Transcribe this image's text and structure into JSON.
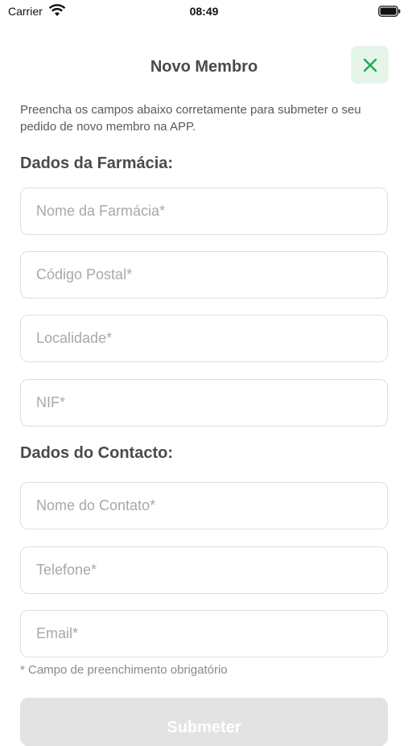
{
  "status_bar": {
    "carrier": "Carrier",
    "time": "08:49"
  },
  "header": {
    "title": "Novo Membro",
    "close_icon": "close-icon"
  },
  "intro_text": "Preencha os campos abaixo corretamente para submeter o seu pedido de novo membro na APP.",
  "sections": {
    "pharmacy": {
      "title": "Dados da Farmácia:",
      "fields": [
        {
          "placeholder": "Nome da Farmácia*",
          "value": ""
        },
        {
          "placeholder": "Código Postal*",
          "value": ""
        },
        {
          "placeholder": "Localidade*",
          "value": ""
        },
        {
          "placeholder": "NIF*",
          "value": ""
        }
      ]
    },
    "contact": {
      "title": "Dados do Contacto:",
      "fields": [
        {
          "placeholder": "Nome do Contato*",
          "value": ""
        },
        {
          "placeholder": "Telefone*",
          "value": ""
        },
        {
          "placeholder": "Email*",
          "value": ""
        }
      ]
    }
  },
  "required_note": "* Campo de preenchimento obrigatório",
  "submit_label": "Submeter",
  "colors": {
    "accent": "#22a94f",
    "close_bg": "#e6f5ea",
    "submit_disabled": "#e3e3e3"
  }
}
